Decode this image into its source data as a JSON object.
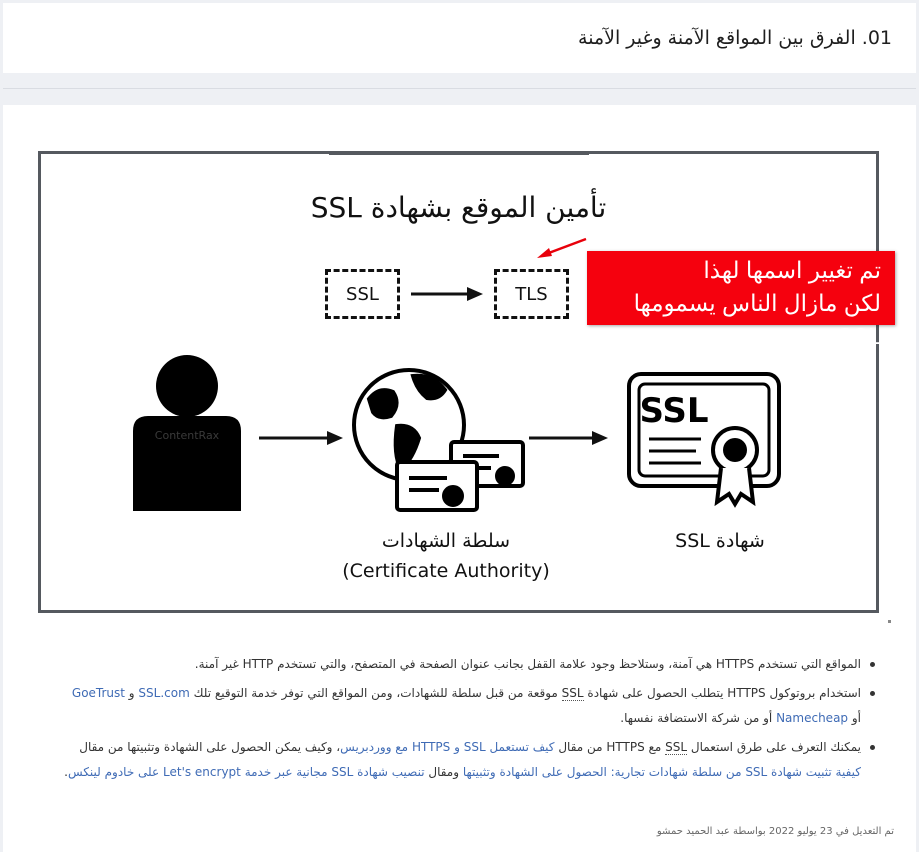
{
  "header": {
    "title": "01. الفرق بين المواقع الآمنة وغير الآمنة"
  },
  "figure": {
    "title": "تأمين الموقع بشهادة SSL",
    "box_old": "SSL",
    "box_new": "TLS",
    "callout_line1": "تم تغيير اسمها لهذا",
    "callout_line2": "لكن مازال الناس يسمومها SSL",
    "user_icon": "user-silhouette-icon",
    "watermark": "ContentRax",
    "ca_icon": "globe-with-certificates-icon",
    "ca_label": "سلطة الشهادات",
    "ca_label_en": "(Certificate Authority)",
    "cert_icon": "ssl-certificate-icon",
    "cert_label": "شهادة SSL",
    "cert_icon_text": "SSL",
    "colors": {
      "callout": "#f5010e",
      "frame": "#55595f"
    }
  },
  "bullets": [
    {
      "text": "المواقع التي تستخدم HTTPS هي آمنة، وستلاحظ وجود علامة القفل بجانب عنوان الصفحة في المتصفح، والتي تستخدم HTTP غير آمنة."
    },
    {
      "part1": "استخدام بروتوكول HTTPS يتطلب الحصول على شهادة ",
      "ssl_term": "SSL",
      "part2": " موقعة من قبل سلطة للشهادات، ومن المواقع التي توفر خدمة التوقيع تلك ",
      "link1": "SSL.com",
      "sep1": " و ",
      "link2": "GoeTrust",
      "sep2": " أو ",
      "link3": "Namecheap",
      "part3": " أو من شركة الاستضافة نفسها."
    },
    {
      "part1": "يمكنك التعرف على طرق استعمال ",
      "ssl_term": "SSL",
      "part2": " مع HTTPS من مقال ",
      "link1": "كيف تستعمل SSL و HTTPS مع ووردبريس",
      "part3": "، وكيف يمكن الحصول على الشهادة وتثبيتها من مقال ",
      "link2": "كيفية تثبيت شهادة SSL من سلطة شهادات تجارية: الحصول على الشهادة وتثبيتها",
      "part4": " ومقال ",
      "link3": "تنصيب شهادة SSL مجانية عبر خدمة Let's encrypt على خادوم لينكس",
      "part5": "."
    }
  ],
  "footer": {
    "meta": "تم التعديل في 23 يوليو 2022 بواسطة عبد الحميد حمشو"
  }
}
